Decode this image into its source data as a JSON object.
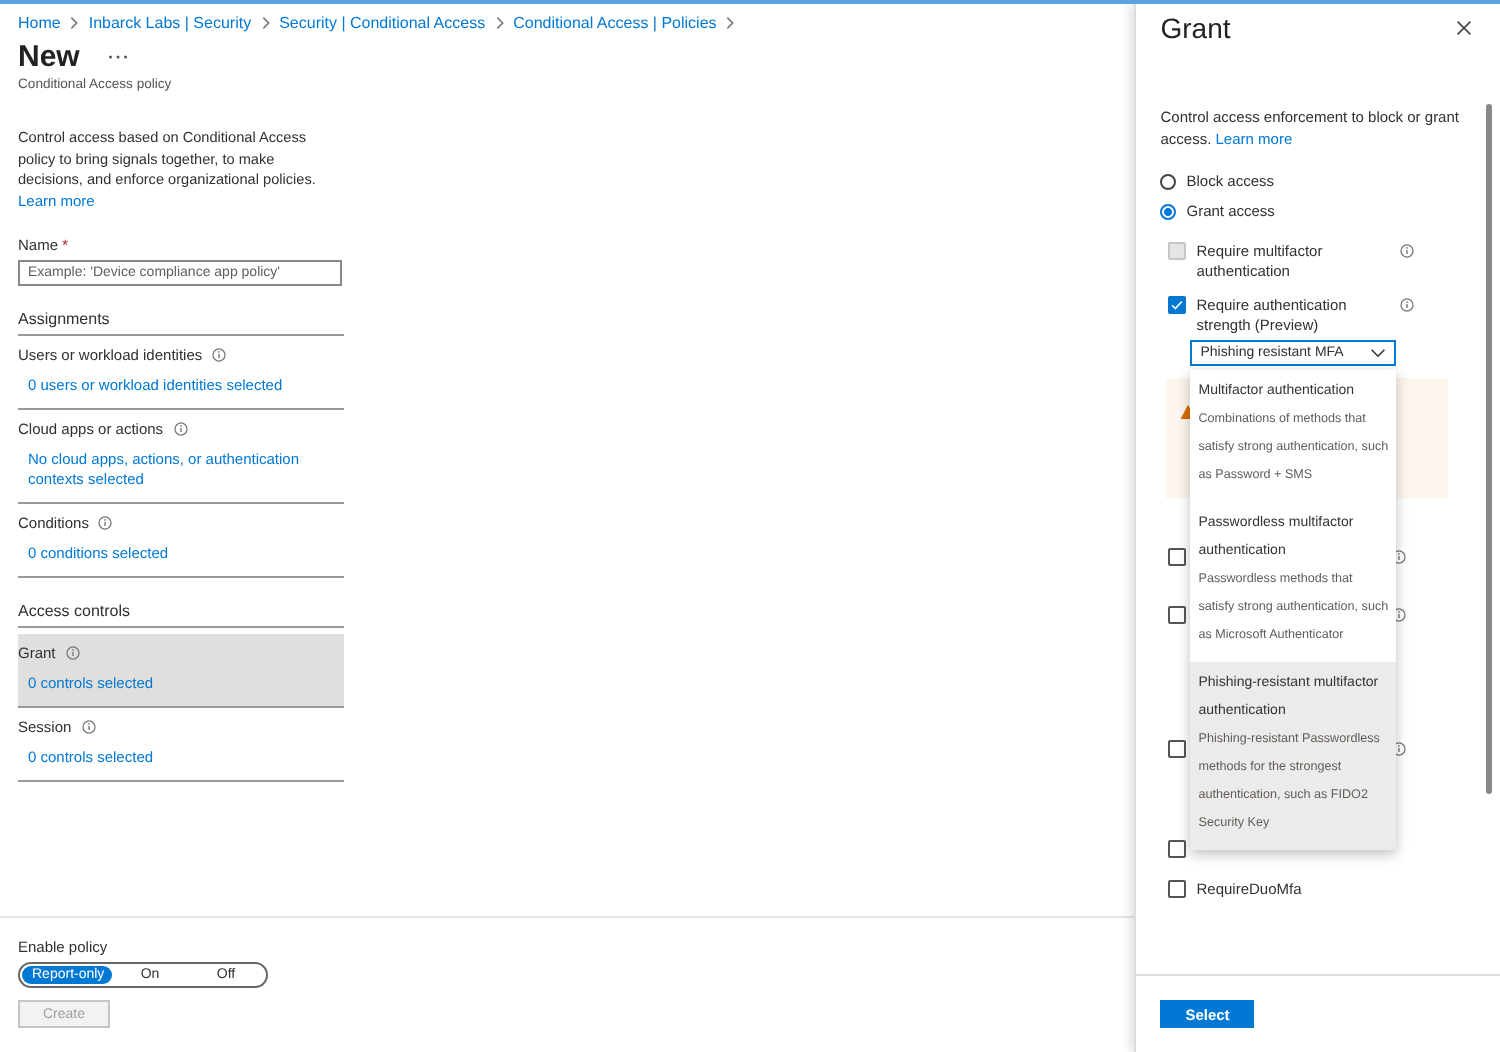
{
  "breadcrumb": [
    "Home",
    "Inbarck Labs | Security",
    "Security | Conditional Access",
    "Conditional Access | Policies"
  ],
  "page": {
    "title": "New",
    "subtitle": "Conditional Access policy"
  },
  "description": {
    "text": "Control access based on Conditional Access policy to bring signals together, to make decisions, and enforce organizational policies.",
    "link": "Learn more"
  },
  "name_field": {
    "label": "Name",
    "required_mark": "*",
    "placeholder": "Example: 'Device compliance app policy'"
  },
  "sections": [
    {
      "heading": "Assignments",
      "items": [
        {
          "label": "Users or workload identities",
          "value": "0 users or workload identities selected",
          "selected": false
        },
        {
          "label": "Cloud apps or actions",
          "value": "No cloud apps, actions, or authentication contexts selected",
          "selected": false
        },
        {
          "label": "Conditions",
          "value": "0 conditions selected",
          "selected": false
        }
      ]
    },
    {
      "heading": "Access controls",
      "items": [
        {
          "label": "Grant",
          "value": "0 controls selected",
          "selected": true
        },
        {
          "label": "Session",
          "value": "0 controls selected",
          "selected": false
        }
      ]
    }
  ],
  "enable_policy": {
    "label": "Enable policy",
    "options": [
      {
        "label": "Report-only",
        "selected": true
      },
      {
        "label": "On",
        "selected": false
      },
      {
        "label": "Off",
        "selected": false
      }
    ]
  },
  "create_button": {
    "label": "Create",
    "disabled": true
  },
  "grant_panel": {
    "title": "Grant",
    "description": "Control access enforcement to block or grant access.",
    "link": "Learn more",
    "access_options": [
      {
        "label": "Block access",
        "selected": false
      },
      {
        "label": "Grant access",
        "selected": true
      }
    ],
    "controls": [
      {
        "label": "Require multifactor authentication",
        "checked": false,
        "disabled": true
      },
      {
        "label": "Require authentication strength (Preview)",
        "checked": true,
        "disabled": false,
        "dropdown": "Phishing resistant MFA"
      }
    ],
    "covered_controls": [
      {
        "checked": false
      },
      {
        "checked": false
      },
      {
        "checked": false
      },
      {
        "checked": false
      }
    ],
    "more_controls": [
      {
        "label": "RequireDuoMfa",
        "checked": false
      }
    ],
    "select_button": "Select"
  },
  "dropdown_options": [
    {
      "title": "Multifactor authentication",
      "description": "Combinations of methods that satisfy strong authentication, such as Password + SMS",
      "highlighted": false
    },
    {
      "title": "Passwordless multifactor authentication",
      "description": "Passwordless methods that satisfy strong authentication, such as Microsoft Authenticator",
      "highlighted": false
    },
    {
      "title": "Phishing-resistant multifactor authentication",
      "description": "Phishing-resistant Passwordless methods for the strongest authentication, such as FIDO2 Security Key",
      "highlighted": true
    }
  ]
}
